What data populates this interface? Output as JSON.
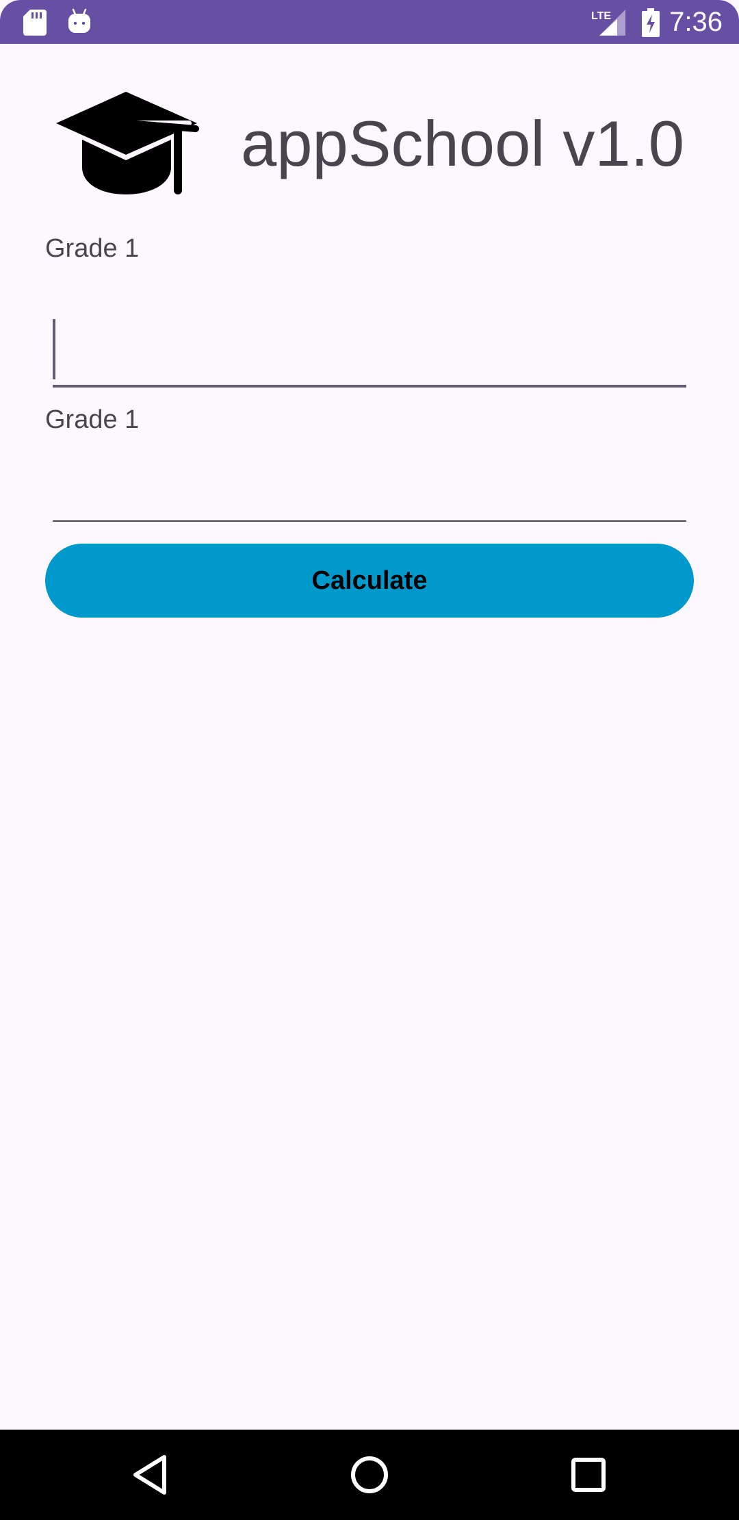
{
  "status_bar": {
    "time": "7:36",
    "network": "LTE",
    "icons": [
      "sd-card-icon",
      "android-debug-icon",
      "lte-signal-icon",
      "battery-charging-icon"
    ],
    "background": "#6750a4"
  },
  "header": {
    "logo_icon": "graduation-cap-icon",
    "title": "appSchool v1.0"
  },
  "form": {
    "grade1": {
      "label": "Grade 1",
      "value": "",
      "placeholder": ""
    },
    "grade2": {
      "label": "Grade 1",
      "value": "",
      "placeholder": ""
    },
    "calculate_label": "Calculate",
    "button_color": "#0099cc"
  },
  "nav_bar": {
    "buttons": [
      "back-icon",
      "home-icon",
      "recents-icon"
    ]
  },
  "colors": {
    "background": "#fdf7fe",
    "text": "#49454f",
    "accent": "#6750a4"
  }
}
